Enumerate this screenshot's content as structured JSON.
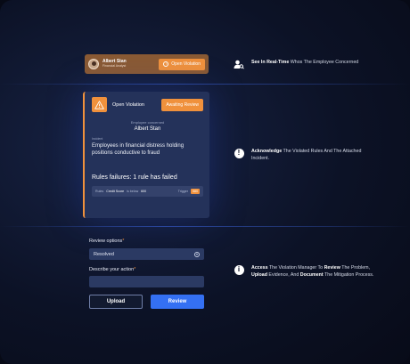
{
  "user_bar": {
    "name": "Albert Stan",
    "role": "Financial Analyst",
    "open_violation_label": "Open Violation"
  },
  "features": [
    {
      "icon": "user-search-icon",
      "parts": [
        {
          "bold": "See In Real-Time"
        },
        {
          "text": " Whos The Employee Concerned"
        }
      ]
    },
    {
      "icon": "alert-circle-icon",
      "parts": [
        {
          "bold": "Acknowledge"
        },
        {
          "text": " The Violated Rules And The Attached Incident."
        }
      ]
    },
    {
      "icon": "info-circle-icon",
      "parts": [
        {
          "bold": "Access"
        },
        {
          "text": " The Violation Manager To "
        },
        {
          "bold": "Review"
        },
        {
          "text": " The Problem, "
        },
        {
          "bold": "Upload"
        },
        {
          "text": " Evidence, And "
        },
        {
          "bold": "Document"
        },
        {
          "text": " The Mitigation Process."
        }
      ]
    }
  ],
  "violation_card": {
    "title": "Open Violation",
    "status": "Awaiting Review",
    "employee_label": "Employee concerned",
    "employee_name": "Albert Stan",
    "incident_label": "Incident",
    "incident_text": "Employees in financial distress holding positions conductive to fraud",
    "rules_failures": "Rules failures: 1 rule has failed",
    "rule": {
      "rule_prefix": "Rules",
      "rule_name": "Credit Score",
      "operator": "is below",
      "threshold": "600",
      "trigger_label": "Trigger",
      "trigger_value": "580"
    }
  },
  "review_form": {
    "options_label": "Review options",
    "options_value": "Resolved",
    "describe_label": "Describe your action",
    "required_mark": "*",
    "upload_label": "Upload",
    "review_label": "Review"
  },
  "colors": {
    "accent_orange": "#f0913c",
    "primary_blue": "#3470f3",
    "background": "#0c1226",
    "card": "#24325a"
  }
}
